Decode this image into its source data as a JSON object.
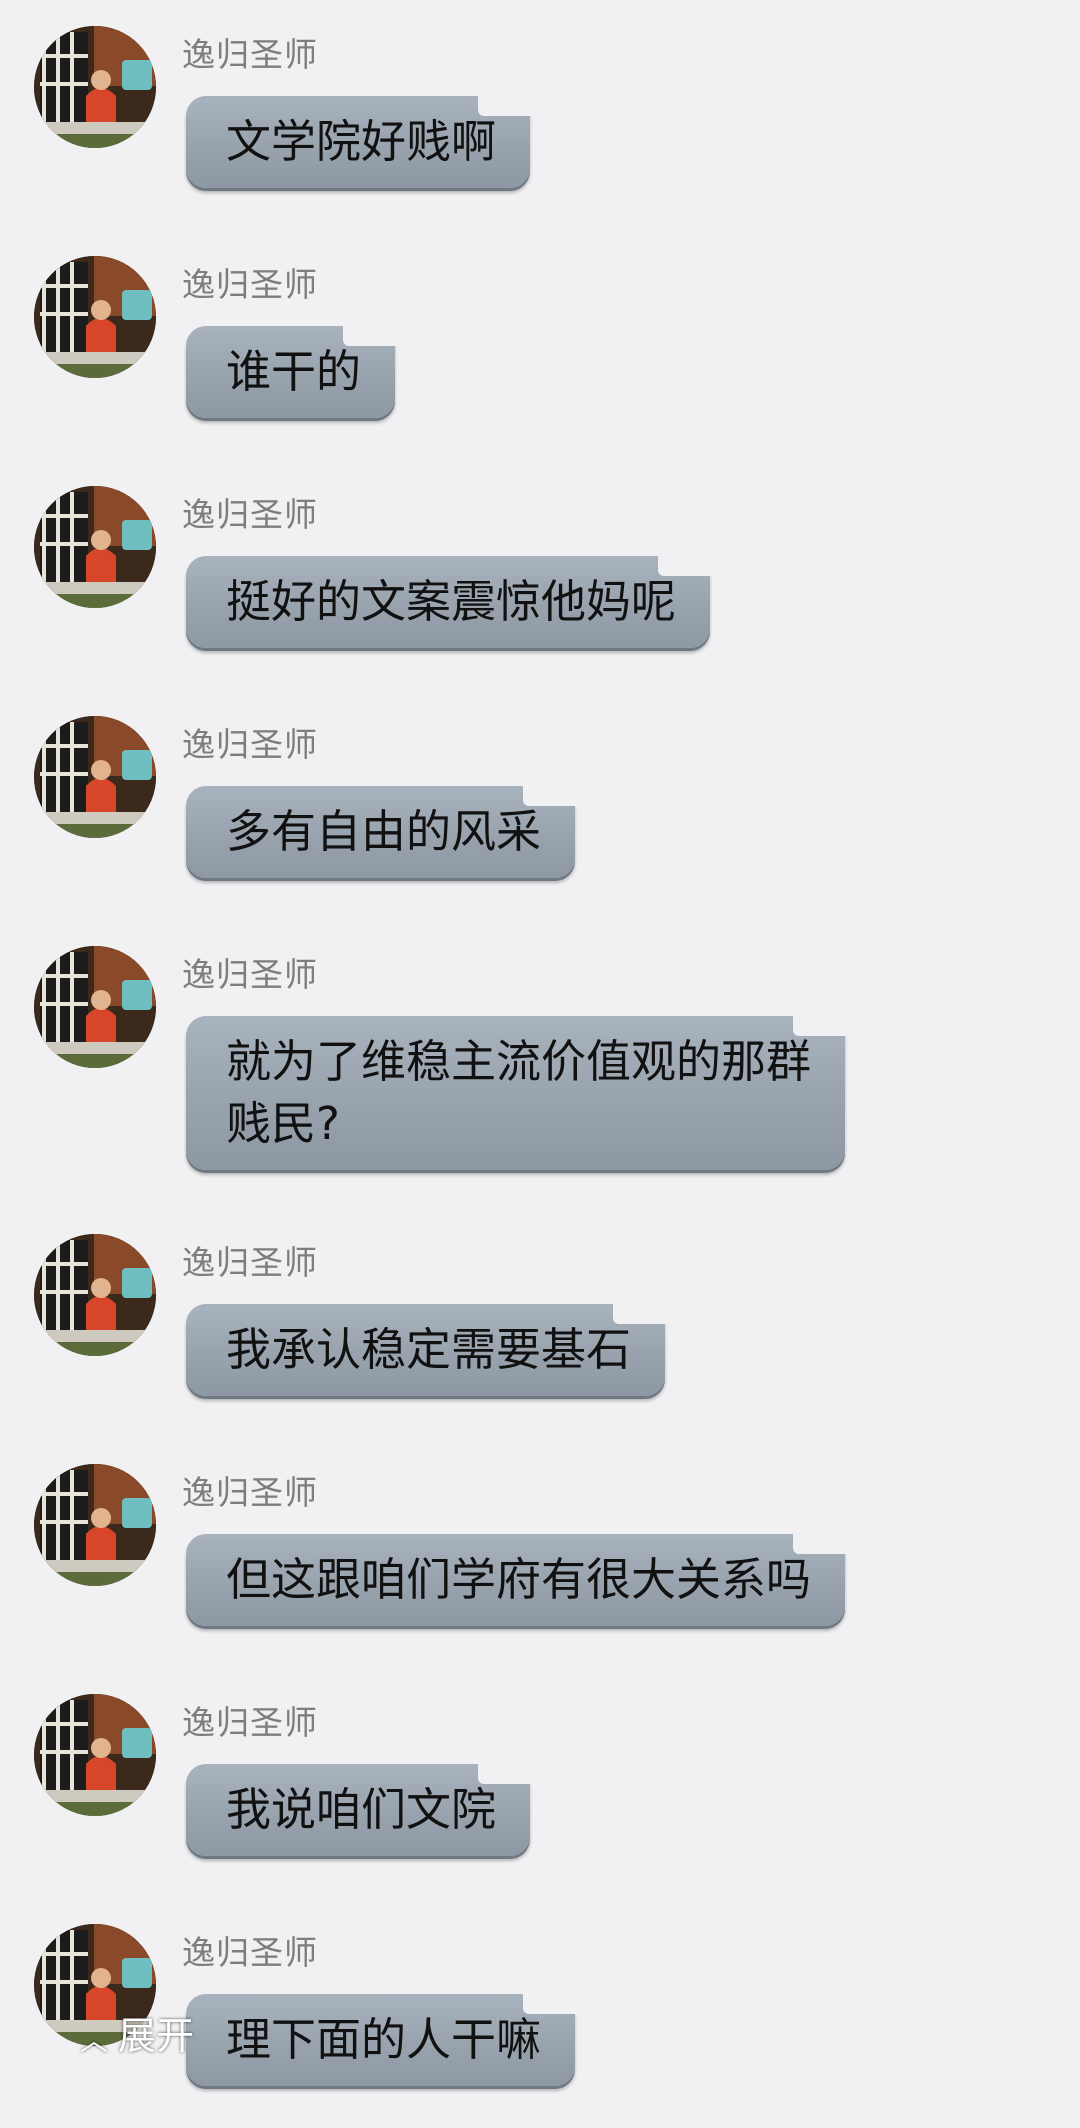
{
  "chat": {
    "sender_name": "逸归圣师",
    "messages": [
      {
        "sender": "逸归圣师",
        "text": "文学院好贱啊"
      },
      {
        "sender": "逸归圣师",
        "text": "谁干的"
      },
      {
        "sender": "逸归圣师",
        "text": "挺好的文案震惊他妈呢"
      },
      {
        "sender": "逸归圣师",
        "text": "多有自由的风采"
      },
      {
        "sender": "逸归圣师",
        "text": "就为了维稳主流价值观的那群\n贱民?"
      },
      {
        "sender": "逸归圣师",
        "text": "我承认稳定需要基石"
      },
      {
        "sender": "逸归圣师",
        "text": "但这跟咱们学府有很大关系吗"
      },
      {
        "sender": "逸归圣师",
        "text": "我说咱们文院"
      },
      {
        "sender": "逸归圣师",
        "text": "理下面的人干嘛"
      }
    ]
  },
  "expand_button": {
    "icon": "chevron-up-icon",
    "label": "展开"
  },
  "colors": {
    "background": "#f1f1f3",
    "bubble": "#9ca6b1",
    "name": "#7d7d7d"
  }
}
